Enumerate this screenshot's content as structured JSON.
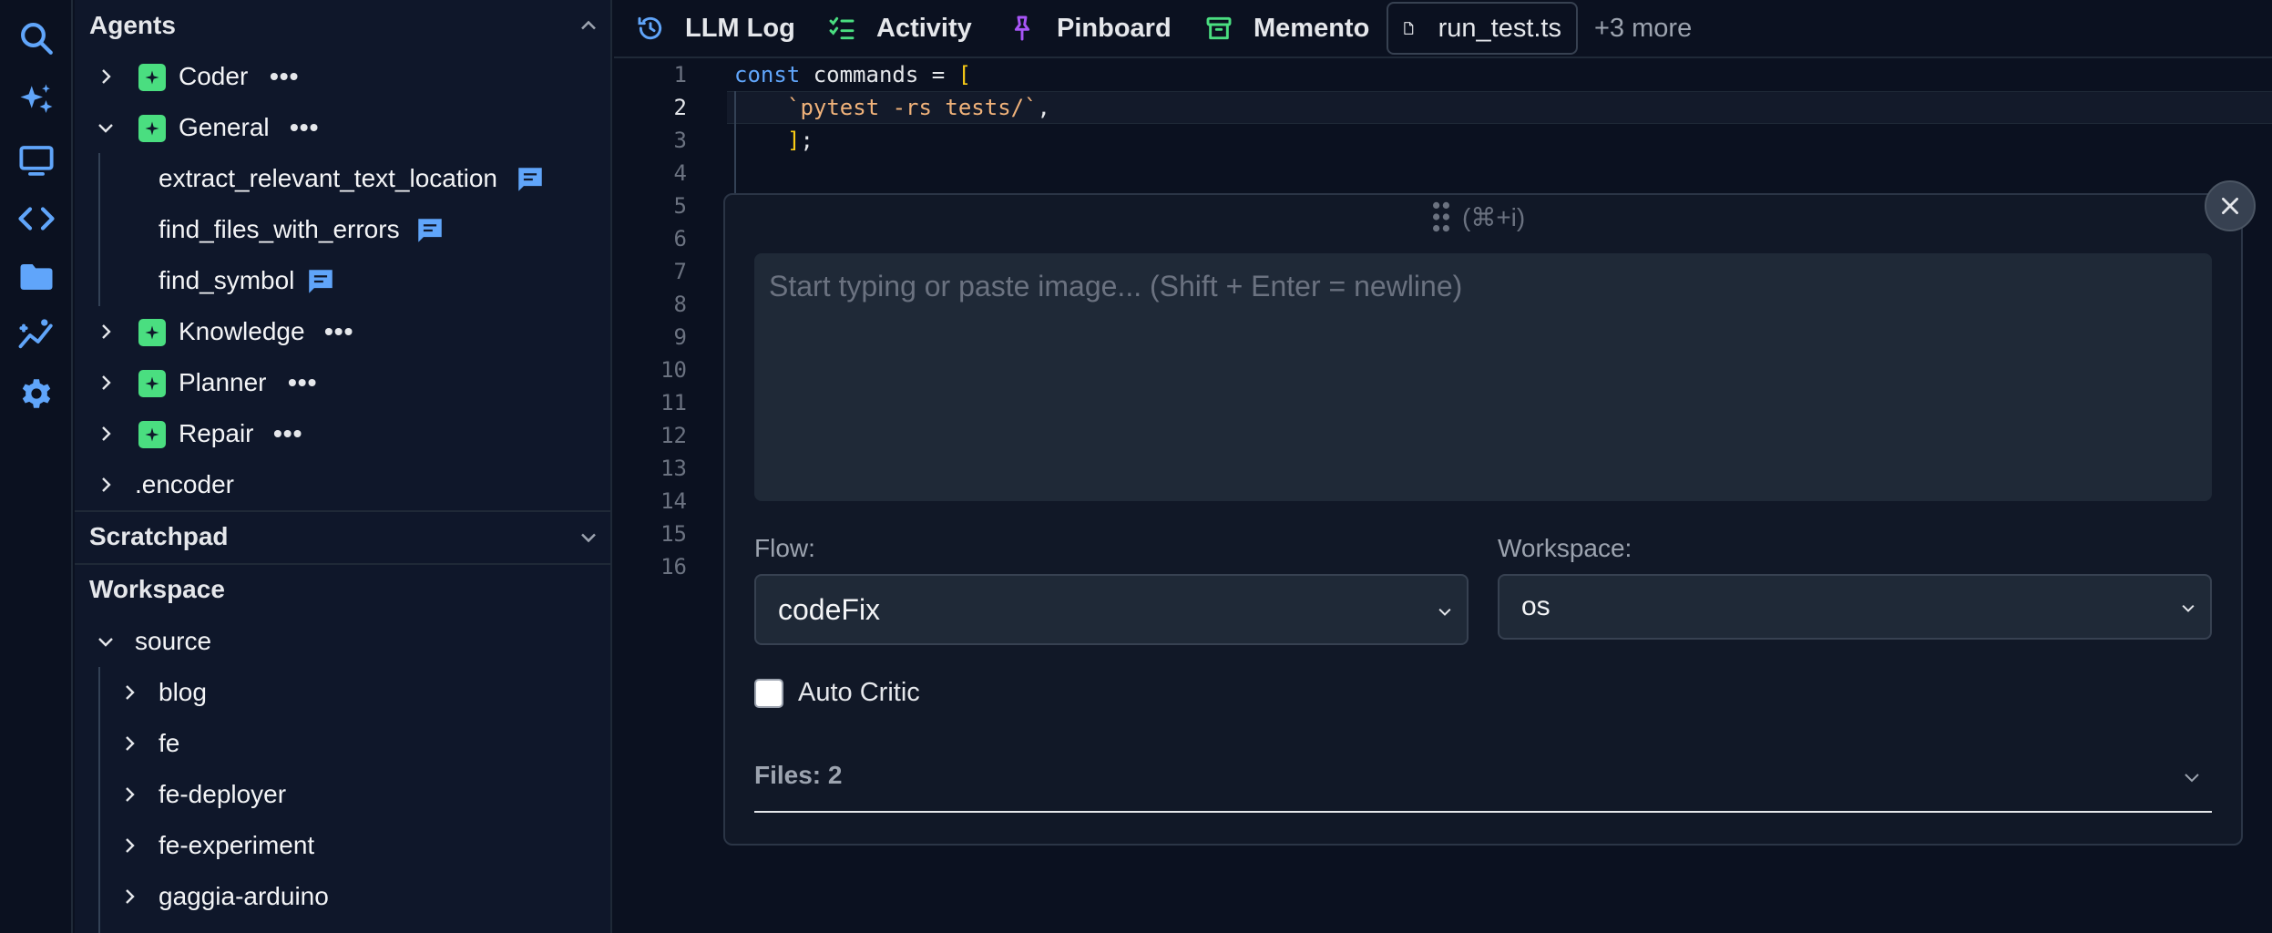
{
  "sidebar": {
    "agents_header": "Agents",
    "agents": [
      {
        "name": "Coder",
        "expanded": false
      },
      {
        "name": "General",
        "expanded": true,
        "children": [
          "extract_relevant_text_location",
          "find_files_with_errors",
          "find_symbol"
        ]
      },
      {
        "name": "Knowledge",
        "expanded": false
      },
      {
        "name": "Planner",
        "expanded": false
      },
      {
        "name": "Repair",
        "expanded": false
      }
    ],
    "encoder_label": ".encoder",
    "more_dots": "•••",
    "scratchpad_header": "Scratchpad",
    "workspace_header": "Workspace",
    "workspace_root": "source",
    "workspace_folders": [
      "blog",
      "fe",
      "fe-deployer",
      "fe-experiment",
      "gaggia-arduino"
    ]
  },
  "tabs": {
    "items": [
      "LLM Log",
      "Activity",
      "Pinboard",
      "Memento"
    ],
    "file_tab": "run_test.ts",
    "more": "+3 more"
  },
  "editor": {
    "line_numbers": [
      "1",
      "2",
      "3",
      "4",
      "5",
      "6",
      "7",
      "8",
      "9",
      "10",
      "11",
      "12",
      "13",
      "14",
      "15",
      "16"
    ],
    "active_line": 2,
    "code": {
      "l1_kw": "const",
      "l1_rest": " commands = ",
      "l1_bracket": "[",
      "l2_str": "`pytest -rs tests/`",
      "l2_comma": ",",
      "l3_bracket": "]",
      "l3_semi": ";"
    }
  },
  "prompt": {
    "shortcut_hint": "(⌘+i)",
    "placeholder": "Start typing or paste image... (Shift + Enter = newline)",
    "flow_label": "Flow:",
    "flow_value": "codeFix",
    "workspace_label": "Workspace:",
    "workspace_value": "os",
    "auto_critic_label": "Auto Critic",
    "auto_critic_checked": false,
    "files_label": "Files: 2"
  },
  "colors": {
    "accent_blue": "#60a5fa",
    "agent_green": "#4ade80",
    "pin_purple": "#a855f7"
  }
}
